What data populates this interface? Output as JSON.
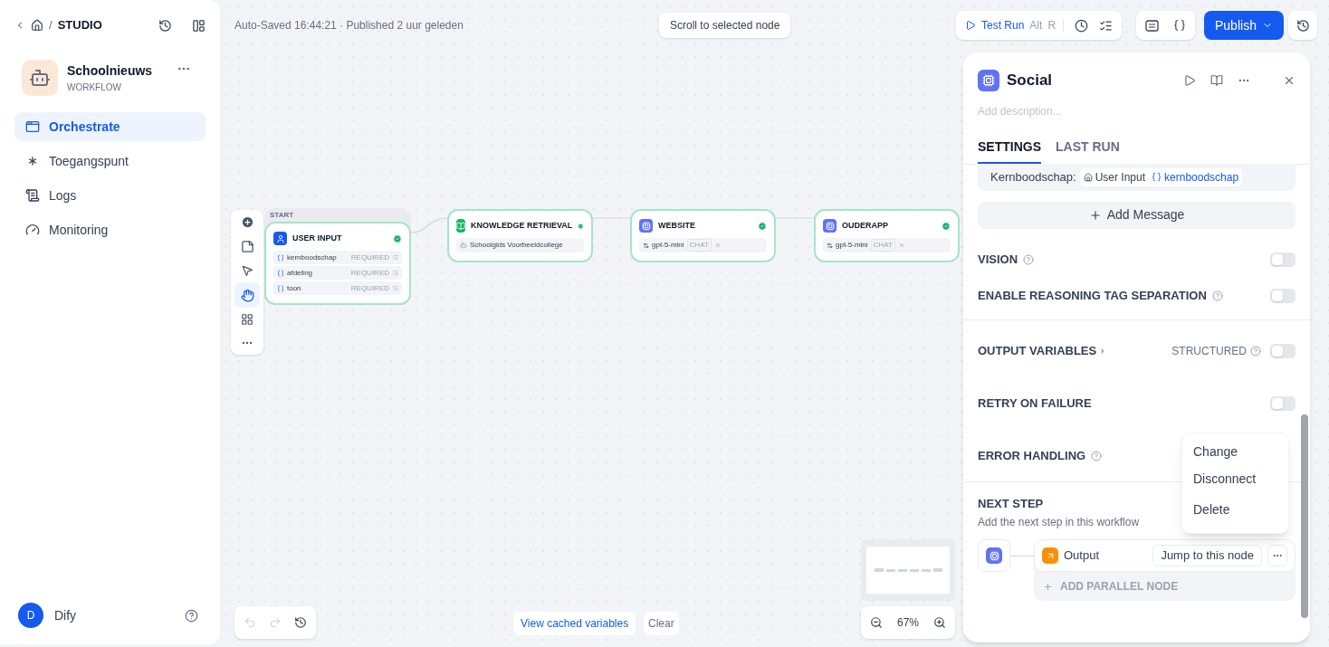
{
  "sidebar": {
    "breadcrumb_separator": "/",
    "breadcrumb": "STUDIO",
    "app": {
      "name": "Schoolnieuws",
      "type": "WORKFLOW"
    },
    "nav": [
      {
        "label": "Orchestrate",
        "kind": "orchestrate",
        "selected": true
      },
      {
        "label": "Toegangspunt",
        "kind": "access",
        "selected": false
      },
      {
        "label": "Logs",
        "kind": "logs",
        "selected": false
      },
      {
        "label": "Monitoring",
        "kind": "monitoring",
        "selected": false
      }
    ],
    "user": {
      "initial": "D",
      "name": "Dify"
    }
  },
  "header": {
    "status": "Auto-Saved 16:44:21 · Published 2 uur geleden",
    "scroll_button": "Scroll to selected node",
    "test_run": {
      "label": "Test Run",
      "keys": [
        "Alt",
        "R"
      ]
    },
    "publish": "Publish"
  },
  "canvas": {
    "nodes": [
      {
        "kind": "start",
        "tag": "START",
        "title": "USER INPUT",
        "variables": [
          {
            "name": "kernboodschap",
            "badge": "REQUIRED"
          },
          {
            "name": "afdeling",
            "badge": "REQUIRED"
          },
          {
            "name": "toon",
            "badge": "REQUIRED"
          }
        ]
      },
      {
        "kind": "knowledge",
        "title": "KNOWLEDGE RETRIEVAL",
        "source": "Schoolgids Voorbeeldcollege"
      },
      {
        "kind": "llm",
        "title": "WEBSITE",
        "model": "gpt-5-mini",
        "mode": "CHAT"
      },
      {
        "kind": "llm",
        "title": "OUDERAPP",
        "model": "gpt-5-mini",
        "mode": "CHAT"
      }
    ],
    "cached_variables": "View cached variables",
    "clear": "Clear",
    "zoom": "67%"
  },
  "panel": {
    "title": "Social",
    "description_placeholder": "Add description...",
    "tabs": [
      {
        "label": "SETTINGS",
        "selected": true
      },
      {
        "label": "LAST RUN",
        "selected": false
      }
    ],
    "prompt": {
      "label": "Kernboodschap:",
      "source": "User Input",
      "variable": "kernboodschap"
    },
    "add_message": "Add Message",
    "settings": [
      {
        "kind": "toggle",
        "label": "VISION",
        "help": true,
        "on": false
      },
      {
        "kind": "toggle",
        "label": "ENABLE REASONING TAG SEPARATION",
        "help": true,
        "on": false
      },
      {
        "kind": "output",
        "label": "OUTPUT VARIABLES",
        "extra": "STRUCTURED",
        "help": false,
        "on": false
      },
      {
        "kind": "toggle",
        "label": "RETRY ON FAILURE",
        "help": false,
        "on": false
      },
      {
        "kind": "label",
        "label": "ERROR HANDLING",
        "help": true
      }
    ],
    "next_step": {
      "title": "NEXT STEP",
      "description": "Add the next step in this workflow",
      "node": "Output",
      "jump": "Jump to this node",
      "add_parallel": "ADD PARALLEL NODE"
    },
    "menu": [
      "Change",
      "Disconnect",
      "Delete"
    ]
  }
}
